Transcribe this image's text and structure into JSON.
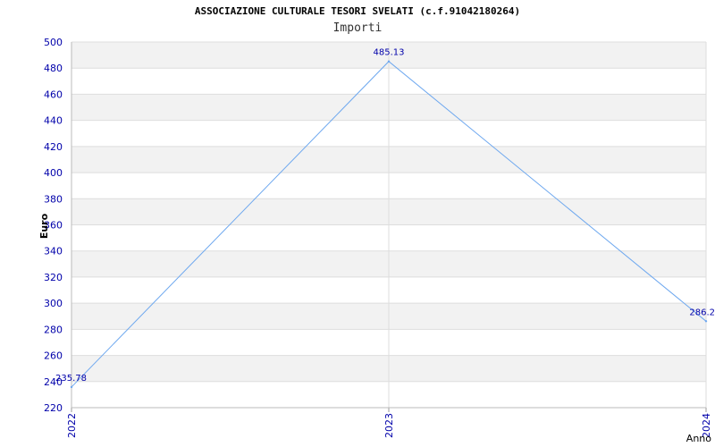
{
  "chart_data": {
    "type": "line",
    "title": "ASSOCIAZIONE CULTURALE TESORI SVELATI (c.f.91042180264)",
    "subtitle": "Importi",
    "xlabel": "Anno",
    "ylabel": "Euro",
    "ylim": [
      220,
      500
    ],
    "y_ticks": [
      220,
      240,
      260,
      280,
      300,
      320,
      340,
      360,
      380,
      400,
      420,
      440,
      460,
      480,
      500
    ],
    "categories": [
      "2022",
      "2023",
      "2024"
    ],
    "series": [
      {
        "values": [
          235.78,
          485.13,
          286.2
        ],
        "labels": [
          "235.78",
          "485.13",
          "286.2"
        ]
      }
    ],
    "grid": true,
    "colors": {
      "line": "#6ea8ef",
      "tick_text": "#0000aa",
      "band": "#f2f2f2",
      "grid": "#dddddd"
    }
  }
}
